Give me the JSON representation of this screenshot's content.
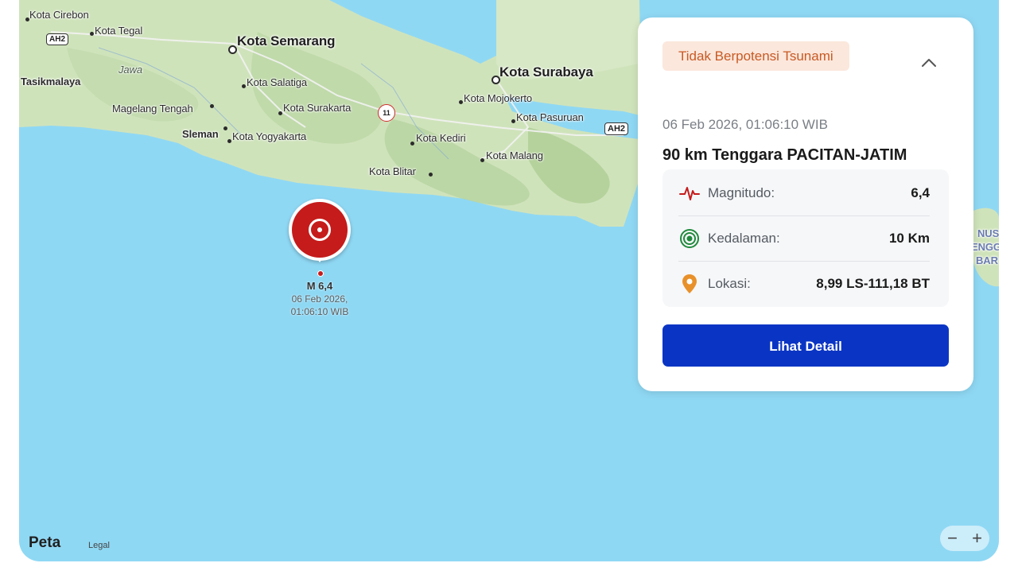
{
  "map": {
    "cities": {
      "kota_cirebon": "Kota Cirebon",
      "kota_tegal": "Kota Tegal",
      "kota_semarang": "Kota Semarang",
      "jawa": "Jawa",
      "tasikmalaya": "Tasikmalaya",
      "kota_salatiga": "Kota Salatiga",
      "magelang_tengah": "Magelang Tengah",
      "kota_surakarta": "Kota Surakarta",
      "sleman": "Sleman",
      "kota_yogyakarta": "Kota Yogyakarta",
      "kota_surabaya": "Kota Surabaya",
      "kota_mojokerto": "Kota Mojokerto",
      "kota_pasuruan": "Kota Pasuruan",
      "kota_kediri": "Kota Kediri",
      "kota_malang": "Kota Malang",
      "kota_blitar": "Kota Blitar",
      "nusa_tenggara_barat": [
        "NUS",
        "ENGG",
        "BAR"
      ]
    },
    "shields": {
      "ah2_west": "AH2",
      "ah2_east": "AH2",
      "route_11": "11"
    },
    "earthquake_marker": {
      "magnitude_label": "M 6,4",
      "date_label": "06 Feb 2026,",
      "time_label": "01:06:10 WIB",
      "color": "#c51b1b"
    },
    "brand": "Peta",
    "legal_label": "Legal",
    "zoom_out": "−",
    "zoom_in": "+"
  },
  "card": {
    "tsunami_badge": "Tidak Berpotensi Tsunami",
    "datetime": "06 Feb 2026, 01:06:10 WIB",
    "location_title": "90 km Tenggara PACITAN-JATIM",
    "rows": [
      {
        "icon": "seismograph-icon",
        "label": "Magnitudo:",
        "value": "6,4",
        "icon_color": "#c51b1b"
      },
      {
        "icon": "depth-target-icon",
        "label": "Kedalaman:",
        "value": "10 Km",
        "icon_color": "#1f8a3b"
      },
      {
        "icon": "location-pin-icon",
        "label": "Lokasi:",
        "value": "8,99 LS-111,18 BT",
        "icon_color": "#e8912a"
      }
    ],
    "detail_button": "Lihat Detail",
    "colors": {
      "badge_bg": "#fbe7dc",
      "badge_text": "#c85a24",
      "button": "#0a35c4"
    }
  }
}
